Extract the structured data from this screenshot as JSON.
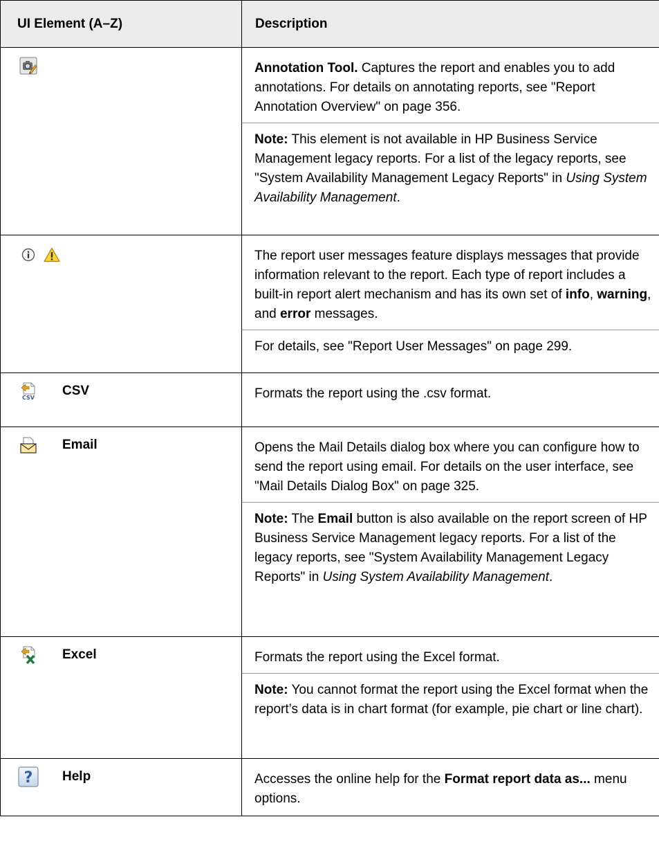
{
  "header": {
    "col_element": "UI Element (A–Z)",
    "col_description": "Description"
  },
  "rows": [
    {
      "label": "",
      "icons": [
        "annotation-tool-icon"
      ],
      "p1": {
        "title": "Annotation Tool.",
        "text": " Captures the report and enables you to add annotations. For details on annotating reports, see \"Report Annotation Overview\" on page 356."
      },
      "p2": {
        "lead": "Note:",
        "text": " This element is not available in HP Business Service Management legacy reports. For a list of the legacy reports, see \"System Availability Management Legacy Reports\" in ",
        "italic": "Using System Availability Management",
        "tail": "."
      }
    },
    {
      "label": "",
      "icons": [
        "info-icon",
        "warning-icon"
      ],
      "p1": {
        "text1": "The report user messages feature displays messages that provide information relevant to the report. Each type of report includes a built-in report alert mechanism and has its own set of ",
        "b1": "info",
        "sep1": ", ",
        "b2": "warning",
        "sep2": ", and ",
        "b3": "error",
        "tail": " messages."
      },
      "p2": {
        "text": "For details, see \"Report User Messages\" on page 299."
      }
    },
    {
      "label": "CSV",
      "icons": [
        "csv-export-icon"
      ],
      "p1": {
        "text": "Formats the report using the .csv format."
      }
    },
    {
      "label": "Email",
      "icons": [
        "email-icon"
      ],
      "p1": {
        "text": "Opens the Mail Details dialog box where you can configure how to send the report using email. For details on the user interface, see \"Mail Details Dialog Box\" on page 325."
      },
      "p2": {
        "lead": "Note:",
        "text1": " The ",
        "b1": "Email",
        "text2": " button is also available on the report screen of HP Business Service Management legacy reports. For a list of the legacy reports, see \"System Availability Management Legacy Reports\" in ",
        "italic": "Using System Availability Management",
        "tail": "."
      }
    },
    {
      "label": "Excel",
      "icons": [
        "excel-export-icon"
      ],
      "p1": {
        "text": "Formats the report using the Excel format."
      },
      "p2": {
        "lead": "Note:",
        "text": " You cannot format the report using the Excel format when the report’s data is in chart format (for example, pie chart or line chart)."
      }
    },
    {
      "label": "Help",
      "icons": [
        "help-icon"
      ],
      "p1": {
        "text1": " Accesses the online help for the ",
        "b1": "Format report data as...",
        "tail": " menu options."
      }
    }
  ]
}
